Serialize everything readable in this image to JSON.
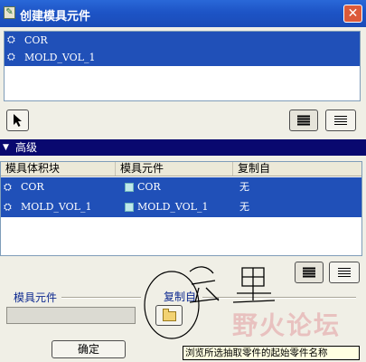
{
  "window": {
    "title": "创建模具元件",
    "icon": "app-icon",
    "close_icon": "close-icon"
  },
  "component_list": {
    "items": [
      {
        "label": "COR",
        "icon": "mold-component-icon",
        "selected": true
      },
      {
        "label": "MOLD_VOL_1",
        "icon": "mold-component-icon",
        "selected": true
      }
    ]
  },
  "toolbar": {
    "select_icon": "pointer-icon",
    "select_all_icon": "select-all-icon",
    "deselect_icon": "deselect-all-icon"
  },
  "advanced": {
    "label": "高级",
    "columns": [
      "模具体积块",
      "模具元件",
      "复制自"
    ],
    "rows": [
      {
        "volume": "COR",
        "component": "COR",
        "copy_from": "无"
      },
      {
        "volume": "MOLD_VOL_1",
        "component": "MOLD_VOL_1",
        "copy_from": "无"
      }
    ]
  },
  "bottom": {
    "mold_component_label": "模具元件",
    "mold_component_value": "",
    "copy_from_label": "复制自",
    "browse_icon": "folder-open-icon",
    "ok_label": "确定",
    "tooltip": "浏览所选抽取零件的起始零件名称",
    "watermark": "野火论坛"
  },
  "colors": {
    "selection": "#2050b8",
    "title_bar": "#1d54c6",
    "section_bar": "#09086f",
    "tooltip_bg": "#ffffe1"
  }
}
